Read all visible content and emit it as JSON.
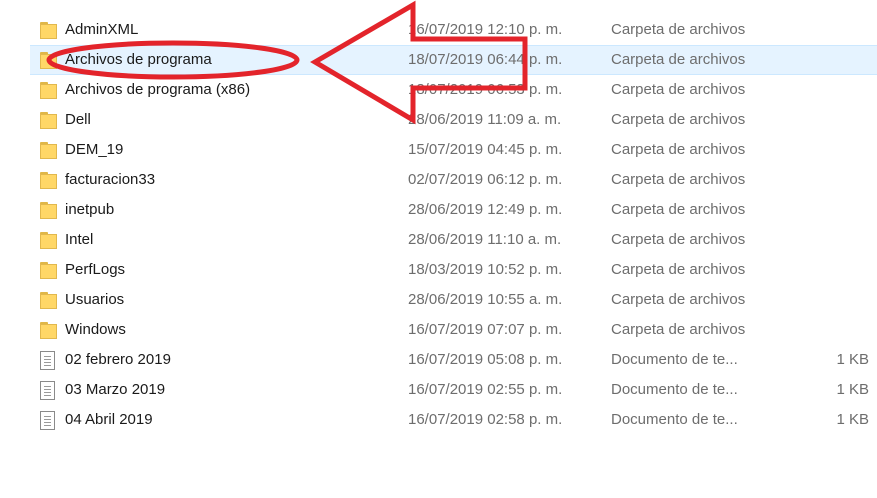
{
  "files": [
    {
      "name": "AdminXML",
      "date": "16/07/2019 12:10 p. m.",
      "type": "Carpeta de archivos",
      "size": "",
      "kind": "folder-icon"
    },
    {
      "name": "Archivos de programa",
      "date": "18/07/2019 06:44 p. m.",
      "type": "Carpeta de archivos",
      "size": "",
      "kind": "folder-icon"
    },
    {
      "name": "Archivos de programa (x86)",
      "date": "18/07/2019 06:53 p. m.",
      "type": "Carpeta de archivos",
      "size": "",
      "kind": "folder-icon"
    },
    {
      "name": "Dell",
      "date": "28/06/2019 11:09 a. m.",
      "type": "Carpeta de archivos",
      "size": "",
      "kind": "folder-icon"
    },
    {
      "name": "DEM_19",
      "date": "15/07/2019 04:45 p. m.",
      "type": "Carpeta de archivos",
      "size": "",
      "kind": "folder-icon"
    },
    {
      "name": "facturacion33",
      "date": "02/07/2019 06:12 p. m.",
      "type": "Carpeta de archivos",
      "size": "",
      "kind": "folder-icon"
    },
    {
      "name": "inetpub",
      "date": "28/06/2019 12:49 p. m.",
      "type": "Carpeta de archivos",
      "size": "",
      "kind": "folder-icon"
    },
    {
      "name": "Intel",
      "date": "28/06/2019 11:10 a. m.",
      "type": "Carpeta de archivos",
      "size": "",
      "kind": "folder-icon"
    },
    {
      "name": "PerfLogs",
      "date": "18/03/2019 10:52 p. m.",
      "type": "Carpeta de archivos",
      "size": "",
      "kind": "folder-icon"
    },
    {
      "name": "Usuarios",
      "date": "28/06/2019 10:55 a. m.",
      "type": "Carpeta de archivos",
      "size": "",
      "kind": "folder-icon"
    },
    {
      "name": "Windows",
      "date": "16/07/2019 07:07 p. m.",
      "type": "Carpeta de archivos",
      "size": "",
      "kind": "folder-icon"
    },
    {
      "name": "02 febrero 2019",
      "date": "16/07/2019 05:08 p. m.",
      "type": "Documento de te...",
      "size": "1 KB",
      "kind": "text-document-icon"
    },
    {
      "name": "03 Marzo 2019",
      "date": "16/07/2019 02:55 p. m.",
      "type": "Documento de te...",
      "size": "1 KB",
      "kind": "text-document-icon"
    },
    {
      "name": "04 Abril 2019",
      "date": "16/07/2019 02:58 p. m.",
      "type": "Documento de te...",
      "size": "1 KB",
      "kind": "text-document-icon"
    }
  ],
  "selected_index": 1,
  "colors": {
    "selection": "#e5f3ff",
    "annotation": "#e3242b",
    "folder": "#ffd767"
  }
}
